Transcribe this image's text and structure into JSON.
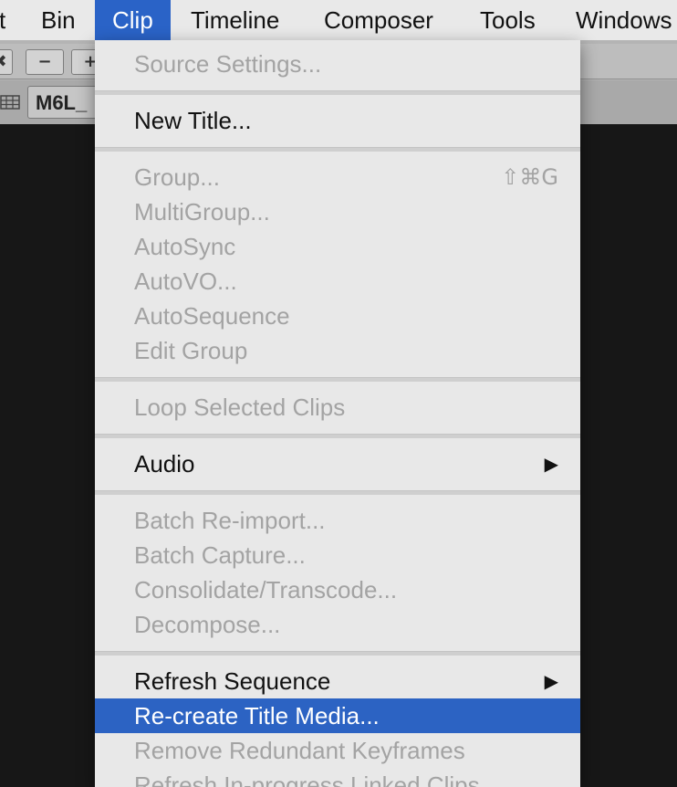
{
  "menubar": {
    "items": [
      {
        "label": "t"
      },
      {
        "label": "Bin"
      },
      {
        "label": "Clip"
      },
      {
        "label": "Timeline"
      },
      {
        "label": "Composer"
      },
      {
        "label": "Tools"
      },
      {
        "label": "Windows"
      }
    ]
  },
  "toolbar": {
    "buttons": [
      "✖",
      "−",
      "+"
    ],
    "bin_name": "M6L_"
  },
  "clip_menu": {
    "items": [
      {
        "label": "Source Settings...",
        "enabled": false
      },
      {
        "label": "New Title...",
        "enabled": true
      },
      {
        "label": "Group...",
        "enabled": false,
        "shortcut": "⇧⌘G"
      },
      {
        "label": "MultiGroup...",
        "enabled": false
      },
      {
        "label": "AutoSync",
        "enabled": false
      },
      {
        "label": "AutoVO...",
        "enabled": false
      },
      {
        "label": "AutoSequence",
        "enabled": false
      },
      {
        "label": "Edit Group",
        "enabled": false
      },
      {
        "label": "Loop Selected Clips",
        "enabled": false
      },
      {
        "label": "Audio",
        "enabled": true,
        "submenu": "▶"
      },
      {
        "label": "Batch Re-import...",
        "enabled": false
      },
      {
        "label": "Batch Capture...",
        "enabled": false
      },
      {
        "label": "Consolidate/Transcode...",
        "enabled": false
      },
      {
        "label": "Decompose...",
        "enabled": false
      },
      {
        "label": "Refresh Sequence",
        "enabled": true,
        "submenu": "▶"
      },
      {
        "label": "Re-create Title Media...",
        "enabled": true,
        "highlighted": true
      },
      {
        "label": "Remove Redundant Keyframes",
        "enabled": false
      },
      {
        "label": "Refresh In-progress Linked Clips",
        "enabled": false
      }
    ]
  },
  "colors": {
    "highlight": "#2c63c3",
    "menu_bg": "#e8e8e8",
    "disabled_text": "#a3a3a3"
  }
}
